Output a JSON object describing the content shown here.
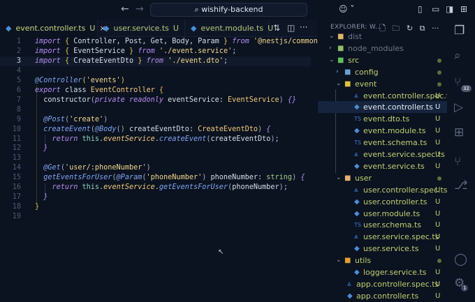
{
  "titlebar": {
    "back_icon": "arrow-left-icon",
    "forward_icon": "arrow-right-icon",
    "search_text": "wishify-backend",
    "search_icon": "search-icon",
    "copilot_icon": "copilot-icon"
  },
  "tabs": [
    {
      "label": "event.controller.ts",
      "status": "U",
      "active": true,
      "close": "×"
    },
    {
      "label": "user.service.ts",
      "status": "U"
    },
    {
      "label": "event.module.ts",
      "status": "U"
    }
  ],
  "tab_actions": {
    "more": "···"
  },
  "editor": {
    "current_line": 3,
    "lines": [
      [
        [
          "kw",
          "import"
        ],
        [
          "pu",
          " "
        ],
        [
          "br",
          "{"
        ],
        [
          "id",
          " Controller, Post, Get, Body, Param "
        ],
        [
          "br",
          "}"
        ],
        [
          "pu",
          " "
        ],
        [
          "kw",
          "from"
        ],
        [
          "pu",
          " "
        ],
        [
          "str",
          "'@nestjs/common'"
        ],
        [
          "pu",
          ";"
        ]
      ],
      [
        [
          "kw",
          "import"
        ],
        [
          "pu",
          " "
        ],
        [
          "br",
          "{"
        ],
        [
          "id",
          " EventService "
        ],
        [
          "br",
          "}"
        ],
        [
          "pu",
          " "
        ],
        [
          "kw",
          "from"
        ],
        [
          "pu",
          " "
        ],
        [
          "str",
          "'./event.service'"
        ],
        [
          "pu",
          ";"
        ]
      ],
      [
        [
          "kw",
          "import"
        ],
        [
          "pu",
          " "
        ],
        [
          "br",
          "{"
        ],
        [
          "id",
          " CreateEventDto "
        ],
        [
          "br",
          "}"
        ],
        [
          "pu",
          " "
        ],
        [
          "kw",
          "from"
        ],
        [
          "pu",
          " "
        ],
        [
          "str",
          "'./event.dto'"
        ],
        [
          "pu",
          ";"
        ]
      ],
      [],
      [
        [
          "dec",
          "@Controller"
        ],
        [
          "br",
          "("
        ],
        [
          "str",
          "'events'"
        ],
        [
          "br",
          ")"
        ]
      ],
      [
        [
          "kw",
          "export"
        ],
        [
          "pu",
          " "
        ],
        [
          "id",
          "class "
        ],
        [
          "cls",
          "EventController"
        ],
        [
          "pu",
          " "
        ],
        [
          "br",
          "{"
        ]
      ],
      [
        [
          "id",
          "  constructor"
        ],
        [
          "par",
          "("
        ],
        [
          "kw",
          "private readonly"
        ],
        [
          "id",
          " eventService: "
        ],
        [
          "cls",
          "EventService"
        ],
        [
          "par",
          ")"
        ],
        [
          "pu",
          " "
        ],
        [
          "kw",
          "{}"
        ]
      ],
      [],
      [
        [
          "dec",
          "  @Post"
        ],
        [
          "par",
          "("
        ],
        [
          "str",
          "'create'"
        ],
        [
          "par",
          ")"
        ]
      ],
      [
        [
          "fn",
          "  createEvent"
        ],
        [
          "par",
          "("
        ],
        [
          "dec",
          "@Body"
        ],
        [
          "par",
          "()"
        ],
        [
          "id",
          " createEventDto: "
        ],
        [
          "cls",
          "CreateEventDto"
        ],
        [
          "par",
          ")"
        ],
        [
          "pu",
          " "
        ],
        [
          "kw",
          "{"
        ]
      ],
      [
        [
          "kw",
          "    return"
        ],
        [
          "pu",
          " "
        ],
        [
          "this",
          "this"
        ],
        [
          "pu",
          "."
        ],
        [
          "prop",
          "eventService"
        ],
        [
          "pu",
          "."
        ],
        [
          "fn",
          "createEvent"
        ],
        [
          "par",
          "("
        ],
        [
          "id",
          "createEventDto"
        ],
        [
          "par",
          ")"
        ],
        [
          "pu",
          ";"
        ]
      ],
      [
        [
          "kw",
          "  }"
        ]
      ],
      [],
      [
        [
          "dec",
          "  @Get"
        ],
        [
          "par",
          "("
        ],
        [
          "str",
          "'user/:phoneNumber'"
        ],
        [
          "par",
          ")"
        ]
      ],
      [
        [
          "fn",
          "  getEventsForUser"
        ],
        [
          "par",
          "("
        ],
        [
          "dec",
          "@Param"
        ],
        [
          "par",
          "("
        ],
        [
          "str",
          "'phoneNumber'"
        ],
        [
          "par",
          ")"
        ],
        [
          "id",
          " phoneNumber: "
        ],
        [
          "ty",
          "string"
        ],
        [
          "par",
          ")"
        ],
        [
          "pu",
          " "
        ],
        [
          "kw",
          "{"
        ]
      ],
      [
        [
          "kw",
          "    return"
        ],
        [
          "pu",
          " "
        ],
        [
          "this",
          "this"
        ],
        [
          "pu",
          "."
        ],
        [
          "prop",
          "eventService"
        ],
        [
          "pu",
          "."
        ],
        [
          "fn",
          "getEventsForUser"
        ],
        [
          "par",
          "("
        ],
        [
          "id",
          "phoneNumber"
        ],
        [
          "par",
          ")"
        ],
        [
          "pu",
          ";"
        ]
      ],
      [
        [
          "kw",
          "  }"
        ]
      ],
      [
        [
          "br",
          "}"
        ]
      ],
      []
    ]
  },
  "explorer": {
    "title": "EXPLORER: W...",
    "actions": [
      "new-file-icon",
      "new-folder-icon",
      "refresh-icon",
      "collapse-icon",
      "more-icon"
    ],
    "items": [
      {
        "label": "dist",
        "depth": 1,
        "type": "folder",
        "open": true,
        "color": "#d9b96a",
        "dim": true
      },
      {
        "label": "node_modules",
        "depth": 1,
        "type": "folder",
        "open": false,
        "color": "#8fbf6a",
        "dim": true
      },
      {
        "label": "src",
        "depth": 1,
        "type": "folder",
        "open": true,
        "color": "#5fbf60",
        "dot": true
      },
      {
        "label": "config",
        "depth": 2,
        "type": "folder",
        "open": false,
        "color": "#6aa0d0",
        "dot": true
      },
      {
        "label": "event",
        "depth": 2,
        "type": "folder",
        "open": true,
        "color": "#e0c040",
        "dot": true
      },
      {
        "label": "event.controller.spec.ts",
        "depth": 3,
        "type": "spec",
        "status": "U"
      },
      {
        "label": "event.controller.ts",
        "depth": 3,
        "type": "nest",
        "status": "U",
        "selected": true
      },
      {
        "label": "event.dto.ts",
        "depth": 3,
        "type": "ts",
        "status": "U"
      },
      {
        "label": "event.module.ts",
        "depth": 3,
        "type": "nest",
        "status": "U"
      },
      {
        "label": "event.schema.ts",
        "depth": 3,
        "type": "ts",
        "status": "U"
      },
      {
        "label": "event.service.spec.ts",
        "depth": 3,
        "type": "spec",
        "status": "U"
      },
      {
        "label": "event.service.ts",
        "depth": 3,
        "type": "nest",
        "status": "U"
      },
      {
        "label": "user",
        "depth": 2,
        "type": "folder",
        "open": true,
        "color": "#e0b070",
        "dot": true
      },
      {
        "label": "user.controller.spec.ts",
        "depth": 3,
        "type": "spec",
        "status": "U"
      },
      {
        "label": "user.controller.ts",
        "depth": 3,
        "type": "nest",
        "status": "U"
      },
      {
        "label": "user.module.ts",
        "depth": 3,
        "type": "nest",
        "status": "U"
      },
      {
        "label": "user.schema.ts",
        "depth": 3,
        "type": "ts",
        "status": "U"
      },
      {
        "label": "user.service.spec.ts",
        "depth": 3,
        "type": "spec",
        "status": "U"
      },
      {
        "label": "user.service.ts",
        "depth": 3,
        "type": "nest",
        "status": "U"
      },
      {
        "label": "utils",
        "depth": 2,
        "type": "folder",
        "open": true,
        "color": "#e0a030",
        "dot": true
      },
      {
        "label": "logger.service.ts",
        "depth": 3,
        "type": "nest",
        "status": "U"
      },
      {
        "label": "app.controller.spec.ts",
        "depth": 2,
        "type": "spec",
        "status": "U"
      },
      {
        "label": "app.controller.ts",
        "depth": 2,
        "type": "nest",
        "status": "U"
      }
    ]
  },
  "activity": {
    "scm_badge": "32",
    "settings_badge": "1"
  }
}
